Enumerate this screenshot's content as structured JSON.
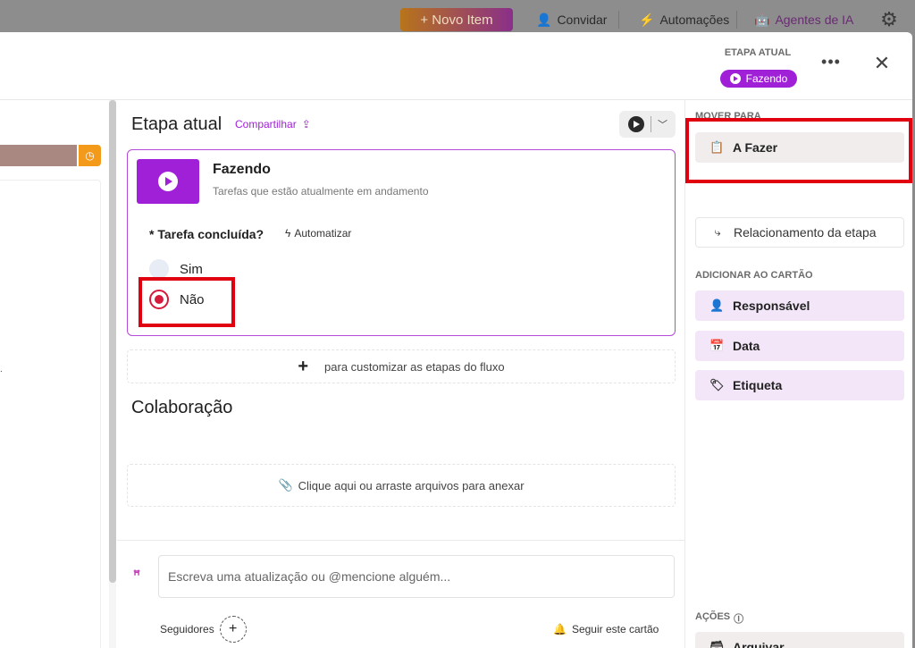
{
  "topbar": {
    "new_item": "+ Novo Item",
    "invite": "Convidar",
    "automations": "Automações",
    "ai_agents": "Agentes de IA"
  },
  "header": {
    "current_stage_label": "ETAPA ATUAL",
    "current_stage_value": "Fazendo",
    "more": "•••",
    "close": "✕"
  },
  "current_stage": {
    "title": "Etapa atual",
    "share": "Compartilhar",
    "stage_name": "Fazendo",
    "stage_desc": "Tarefas que estão atualmente em andamento",
    "question": "* Tarefa concluída?",
    "automate": "Automatizar",
    "options": [
      "Sim",
      "Não"
    ],
    "selected": "Não"
  },
  "customize": {
    "plus": "+",
    "text": "para customizar as etapas do fluxo"
  },
  "collaboration": {
    "title": "Colaboração",
    "attach": "Clique aqui ou arraste arquivos para anexar"
  },
  "update": {
    "placeholder": "Escreva uma atualização ou @mencione alguém...",
    "followers": "Seguidores",
    "add_follower": "+",
    "follow_card": "Seguir este cartão"
  },
  "sidebar": {
    "move_to_label": "MOVER PARA",
    "move_to": "A Fazer",
    "stage_relation": "Relacionamento da etapa",
    "add_to_card_label": "ADICIONAR AO CARTÃO",
    "add_items": [
      "Responsável",
      "Data",
      "Etiqueta"
    ],
    "actions_label": "AÇÕES",
    "archive": "Arquivar"
  },
  "colors": {
    "accent": "#a020d8",
    "highlight": "#e0000f",
    "radio_selected": "#d61a3c"
  }
}
